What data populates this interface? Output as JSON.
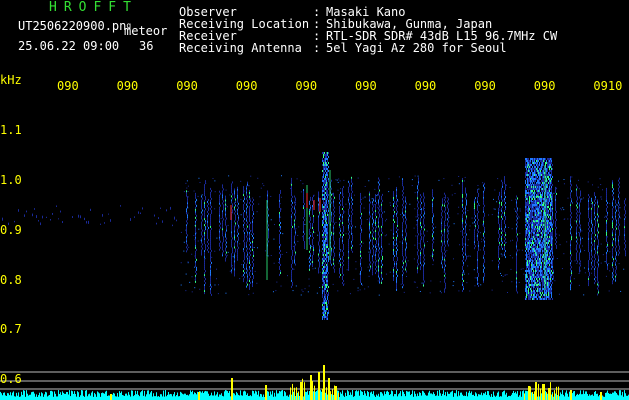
{
  "header": {
    "program": "HROFFT",
    "filename": "UT2506220900.pn",
    "file_suffix": "g",
    "meteor_label": "meteor",
    "date": "25.06.22 09:00",
    "count": "36",
    "fields": [
      {
        "label": "Observer",
        "value": "Masaki Kano"
      },
      {
        "label": "Receiving Location",
        "value": "Shibukawa, Gunma, Japan"
      },
      {
        "label": "Receiver",
        "value": "RTL-SDR SDR# 43dB L15 96.7MHz CW"
      },
      {
        "label": "Receiving Antenna",
        "value": "5el Yagi Az 280 for Seoul"
      }
    ]
  },
  "chart_data": {
    "type": "heatmap",
    "ylabel": "kHz",
    "y_ticks": [
      "1.1",
      "1.0",
      "0.9",
      "0.8",
      "0.7",
      "0.6"
    ],
    "x_ticks": [
      "090",
      "090",
      "090",
      "090",
      "090",
      "090",
      "090",
      "090",
      "090",
      "0910"
    ],
    "colors": {
      "background": "#000000",
      "low": "#1a2a9a",
      "mid": "#1e7aff",
      "high": "#33ff88",
      "peak": "#ff3030",
      "axis_text": "#ffff00",
      "activity_bars": "#ffff00",
      "activity_base": "#00ffff"
    }
  }
}
